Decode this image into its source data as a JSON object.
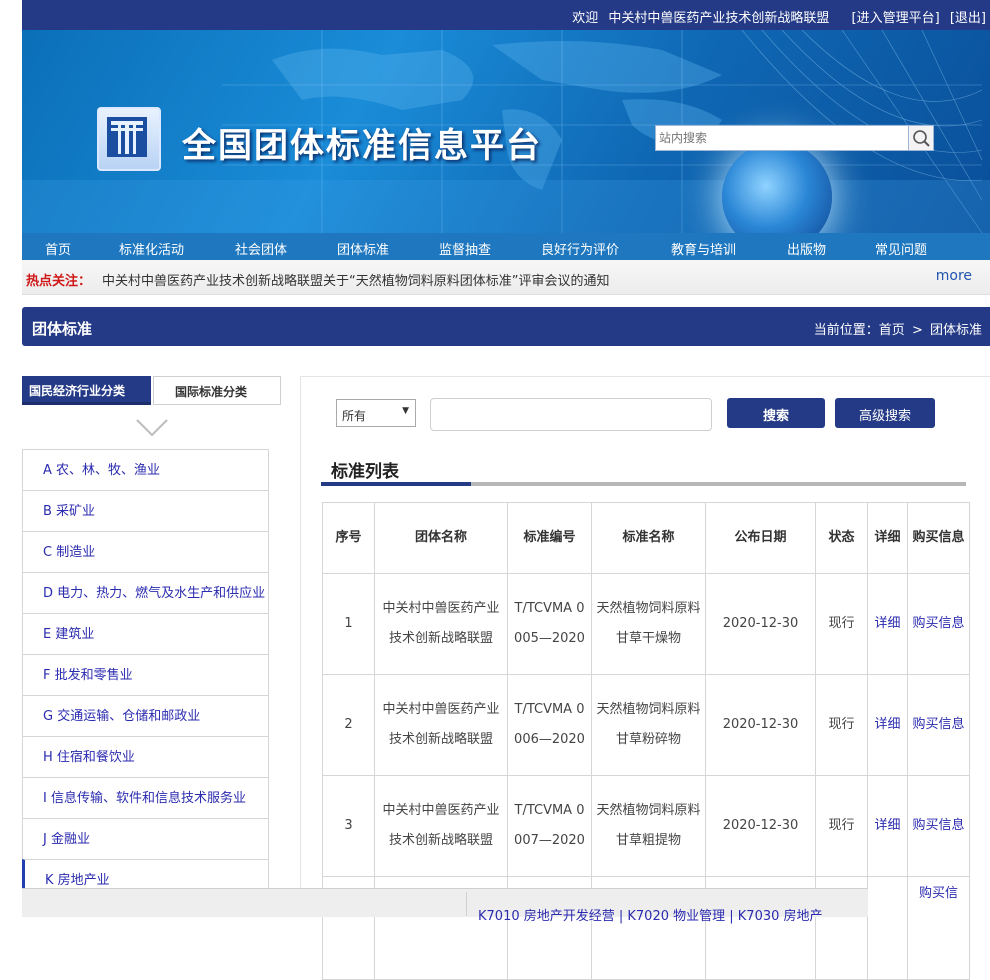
{
  "topbar": {
    "welcome": "欢迎",
    "org_name": "中关村中兽医药产业技术创新战略联盟",
    "admin_link": "[进入管理平台]",
    "logout_link": "[退出]"
  },
  "header": {
    "site_title": "全国团体标准信息平台",
    "search_placeholder": "站内搜索",
    "search_icon": "magnifier-icon"
  },
  "nav": {
    "items": [
      "首页",
      "标准化活动",
      "社会团体",
      "团体标准",
      "监督抽查",
      "良好行为评价",
      "教育与培训",
      "出版物",
      "常见问题"
    ]
  },
  "hot": {
    "label": "热点关注：",
    "text": "中关村中兽医药产业技术创新战略联盟关于“天然植物饲料原料团体标准”评审会议的通知",
    "more": "more"
  },
  "section": {
    "title": "团体标准",
    "crumb_prefix": "当前位置：",
    "crumb_home": "首页",
    "crumb_sep": ">",
    "crumb_current": "团体标准"
  },
  "sidebar": {
    "tab_active": "国民经济行业分类",
    "tab_inactive": "国际标准分类",
    "categories": [
      "A 农、林、牧、渔业",
      "B 采矿业",
      "C 制造业",
      "D 电力、热力、燃气及水生产和供应业",
      "E 建筑业",
      "F 批发和零售业",
      "G 交通运输、仓储和邮政业",
      "H 住宿和餐饮业",
      "I 信息传输、软件和信息技术服务业",
      "J 金融业",
      "K 房地产业"
    ]
  },
  "search": {
    "type_selected": "所有",
    "search_button": "搜索",
    "advanced_button": "高级搜索"
  },
  "list": {
    "title": "标准列表",
    "headers": [
      "序号",
      "团体名称",
      "标准编号",
      "标准名称",
      "公布日期",
      "状态",
      "详细",
      "购买信息"
    ],
    "rows": [
      [
        "1",
        "中关村中兽医药产业技术创新战略联盟",
        "T/TCVMA 0005—2020",
        "天然植物饲料原料 甘草干燥物",
        "2020-12-30",
        "现行",
        "详细",
        "购买信息"
      ],
      [
        "2",
        "中关村中兽医药产业技术创新战略联盟",
        "T/TCVMA 0006—2020",
        "天然植物饲料原料 甘草粉碎物",
        "2020-12-30",
        "现行",
        "详细",
        "购买信息"
      ],
      [
        "3",
        "中关村中兽医药产业技术创新战略联盟",
        "T/TCVMA 0007—2020",
        "天然植物饲料原料 甘草粗提物",
        "2020-12-30",
        "现行",
        "详细",
        "购买信息"
      ]
    ],
    "partial_last_cell": "购买信"
  },
  "popup": {
    "text": "K7010 房地产开发经营 | K7020 物业管理 | K7030 房地产"
  },
  "colors": {
    "primary": "#243a86",
    "nav": "#1f78bf",
    "hot_label": "#d01818",
    "link": "#2b2bb0"
  }
}
